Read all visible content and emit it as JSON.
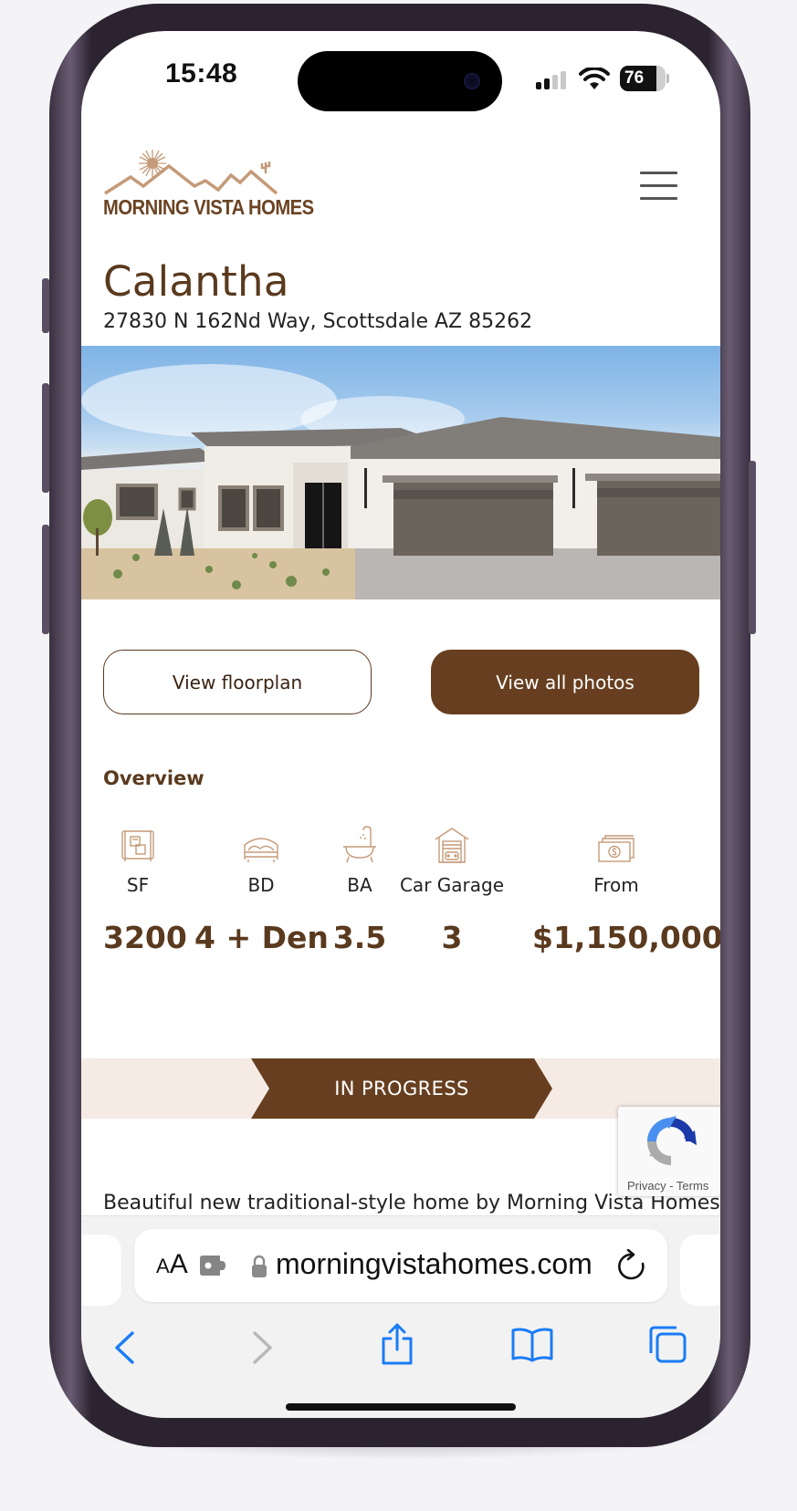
{
  "status_bar": {
    "time": "15:48",
    "battery": "76",
    "signal_bars_active": 2,
    "signal_bars_total": 4
  },
  "header": {
    "logo_text": "MORNING VISTA HOMES",
    "logo_icon": "sun-mountains-cactus-logo",
    "menu_icon": "hamburger-menu-icon"
  },
  "listing": {
    "name": "Calantha",
    "address": "27830 N 162Nd Way, Scottsdale AZ 85262",
    "hero_image_alt": "Single-story white stucco home with gray tile roof and three-car garage",
    "buttons": {
      "floorplan": "View floorplan",
      "photos": "View all photos"
    }
  },
  "overview": {
    "heading": "Overview",
    "stats": [
      {
        "icon": "blueprint-icon",
        "label": "SF",
        "value": "3200"
      },
      {
        "icon": "bed-icon",
        "label": "BD",
        "value": "4 + Den"
      },
      {
        "icon": "bathtub-icon",
        "label": "BA",
        "value": "3.5"
      },
      {
        "icon": "garage-icon",
        "label": "Car Garage",
        "value": "3"
      },
      {
        "icon": "money-icon",
        "label": "From",
        "value": "$1,150,000"
      }
    ]
  },
  "status_banner": {
    "label": "IN PROGRESS"
  },
  "recaptcha": {
    "links": "Privacy - Terms"
  },
  "description": {
    "first_line": "Beautiful new traditional-style home by Morning Vista Homes"
  },
  "browser": {
    "aa_small": "A",
    "aa_large": "A",
    "url": "morningvistahomes.com"
  },
  "colors": {
    "brand_brown": "#673f20",
    "brand_text": "#5a3a1e",
    "logo_tan": "#c49a78",
    "banner_bg": "#f5ebe4",
    "ios_blue": "#1a7cf5"
  }
}
